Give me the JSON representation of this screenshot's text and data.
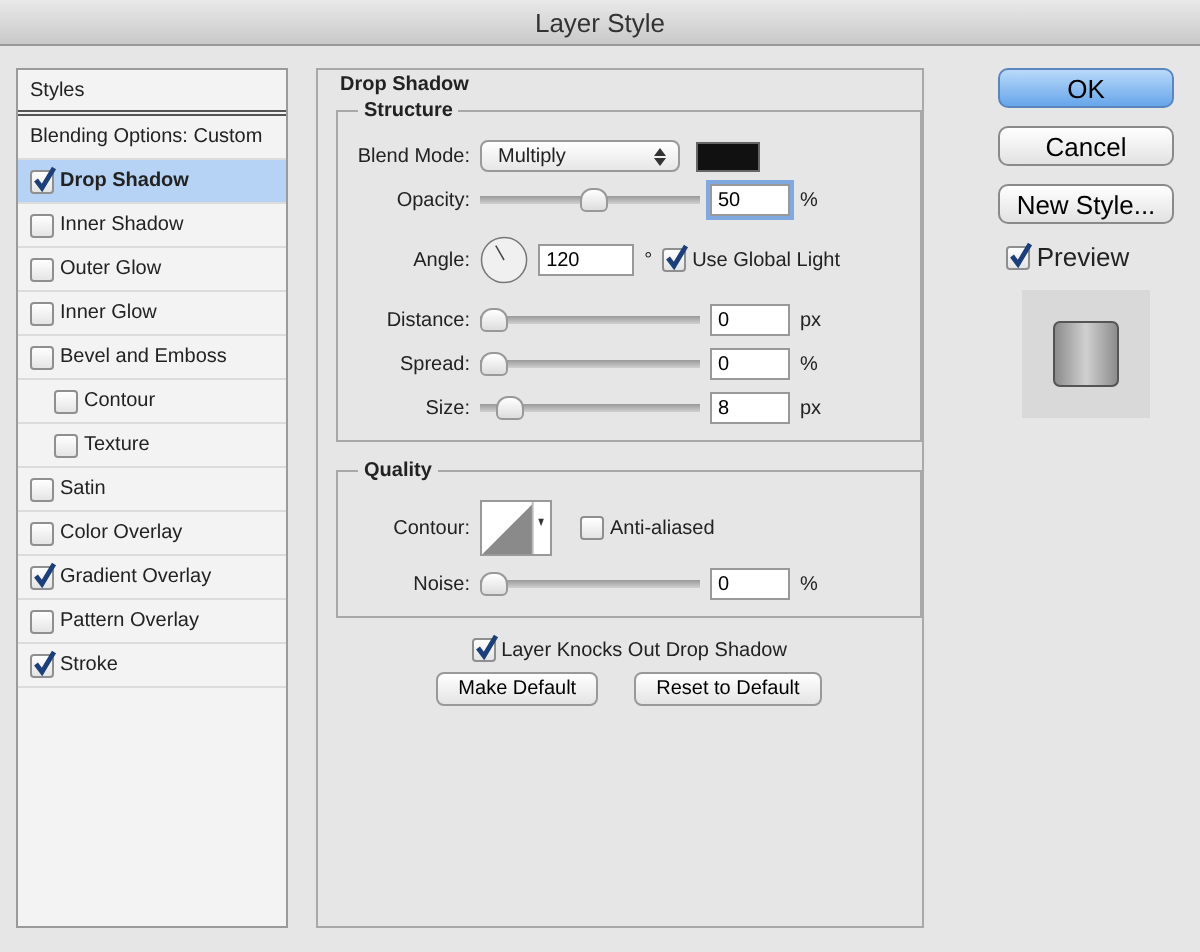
{
  "window": {
    "title": "Layer Style"
  },
  "styles_panel": {
    "header": "Styles",
    "blending_options": "Blending Options: Custom",
    "items": [
      {
        "label": "Drop Shadow",
        "checked": true,
        "selected": true
      },
      {
        "label": "Inner Shadow",
        "checked": false,
        "selected": false
      },
      {
        "label": "Outer Glow",
        "checked": false,
        "selected": false
      },
      {
        "label": "Inner Glow",
        "checked": false,
        "selected": false
      },
      {
        "label": "Bevel and Emboss",
        "checked": false,
        "selected": false,
        "children": [
          {
            "label": "Contour",
            "checked": false,
            "selected": false
          },
          {
            "label": "Texture",
            "checked": false,
            "selected": false
          }
        ]
      },
      {
        "label": "Satin",
        "checked": false,
        "selected": false
      },
      {
        "label": "Color Overlay",
        "checked": false,
        "selected": false
      },
      {
        "label": "Gradient Overlay",
        "checked": true,
        "selected": false
      },
      {
        "label": "Pattern Overlay",
        "checked": false,
        "selected": false
      },
      {
        "label": "Stroke",
        "checked": true,
        "selected": false
      }
    ]
  },
  "drop_shadow": {
    "title": "Drop Shadow",
    "structure": {
      "title": "Structure",
      "blend_mode": {
        "label": "Blend Mode:",
        "value": "Multiply",
        "color": "#111111"
      },
      "opacity": {
        "label": "Opacity:",
        "level": 0.52,
        "value": "50",
        "unit": "%",
        "focused": true
      },
      "angle": {
        "label": "Angle:",
        "value": "120",
        "unit": "°",
        "use_global_light": {
          "label": "Use Global Light",
          "checked": true
        }
      },
      "sliders": [
        {
          "label": "Distance:",
          "level": 0,
          "value": "0",
          "unit": "px",
          "focused": false
        },
        {
          "label": "Spread:",
          "level": 0,
          "value": "0",
          "unit": "%",
          "focused": false
        },
        {
          "label": "Size:",
          "level": 0.08,
          "value": "8",
          "unit": "px",
          "focused": false
        }
      ]
    },
    "quality": {
      "title": "Quality",
      "contour": {
        "label": "Contour:"
      },
      "anti_aliased": {
        "label": "Anti-aliased",
        "checked": false
      },
      "noise": {
        "label": "Noise:",
        "level": 0,
        "value": "0",
        "unit": "%",
        "focused": false
      }
    },
    "knockout": {
      "label": "Layer Knocks Out Drop Shadow",
      "checked": true
    },
    "buttons": [
      "Make Default",
      "Reset to Default"
    ]
  },
  "actions": [
    {
      "label": "OK",
      "default": true
    },
    {
      "label": "Cancel",
      "default": false
    },
    {
      "label": "New Style...",
      "default": false
    }
  ],
  "preview": {
    "label": "Preview",
    "checked": true
  }
}
